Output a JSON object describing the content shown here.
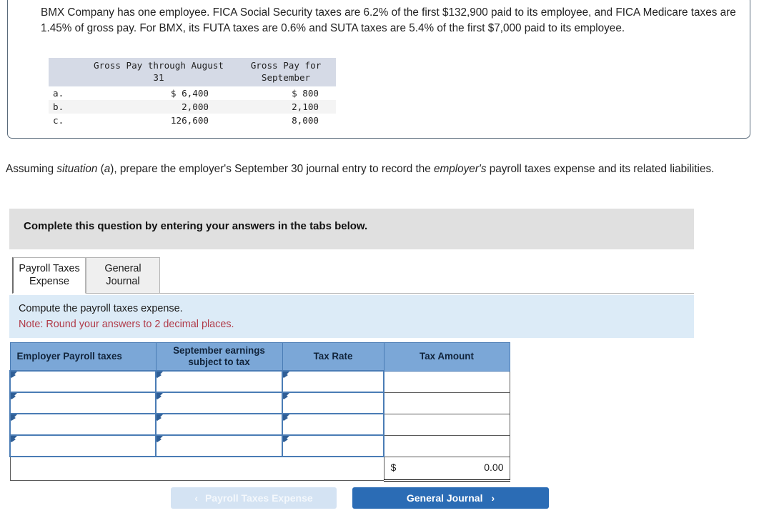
{
  "problem": {
    "text": "BMX Company has one employee. FICA Social Security taxes are 6.2% of the first $132,900 paid to its employee, and FICA Medicare taxes are 1.45% of gross pay. For BMX, its FUTA taxes are 0.6% and SUTA taxes are 5.4% of the first $7,000 paid to its employee."
  },
  "gross_pay_table": {
    "headers": {
      "blank": "",
      "through_august": "Gross Pay through August 31",
      "for_september": "Gross Pay for September"
    },
    "rows": [
      {
        "label": "a.",
        "through_august": "$ 6,400",
        "for_september": "$ 800"
      },
      {
        "label": "b.",
        "through_august": "2,000",
        "for_september": "2,100"
      },
      {
        "label": "c.",
        "through_august": "126,600",
        "for_september": "8,000"
      }
    ]
  },
  "assuming": {
    "part1": "Assuming ",
    "italic1": "situation",
    "part2": " (",
    "italic2": "a",
    "part3": "), prepare the employer's September 30 journal entry to record the ",
    "italic3": "employer's",
    "part4": " payroll taxes expense and its related liabilities."
  },
  "banner": {
    "text": "Complete this question by entering your answers in the tabs below."
  },
  "tabs": [
    {
      "label": "Payroll Taxes Expense",
      "active": true
    },
    {
      "label": "General Journal",
      "active": false
    }
  ],
  "note": {
    "line1": "Compute the payroll taxes expense.",
    "line2": "Note: Round your answers to 2 decimal places."
  },
  "answer_table": {
    "headers": [
      "Employer Payroll taxes",
      "September earnings subject to tax",
      "Tax Rate",
      "Tax Amount"
    ],
    "rows": [
      {
        "tax": "",
        "earnings": "",
        "rate": "",
        "amount": ""
      },
      {
        "tax": "",
        "earnings": "",
        "rate": "",
        "amount": ""
      },
      {
        "tax": "",
        "earnings": "",
        "rate": "",
        "amount": ""
      },
      {
        "tax": "",
        "earnings": "",
        "rate": "",
        "amount": ""
      }
    ],
    "total": {
      "currency": "$",
      "value": "0.00"
    }
  },
  "nav": {
    "prev_label": "Payroll Taxes Expense",
    "prev_chevron": "‹",
    "next_label": "General Journal",
    "next_chevron": "›"
  },
  "colors": {
    "header_blue": "#7ba7d7",
    "note_blue": "#dcebf7",
    "banner_gray": "#e0e0e0",
    "note_red": "#b03a48",
    "primary_button": "#2b6cb5",
    "disabled_button": "#d4e3f3",
    "gross_header_gray": "#d5dae6"
  }
}
